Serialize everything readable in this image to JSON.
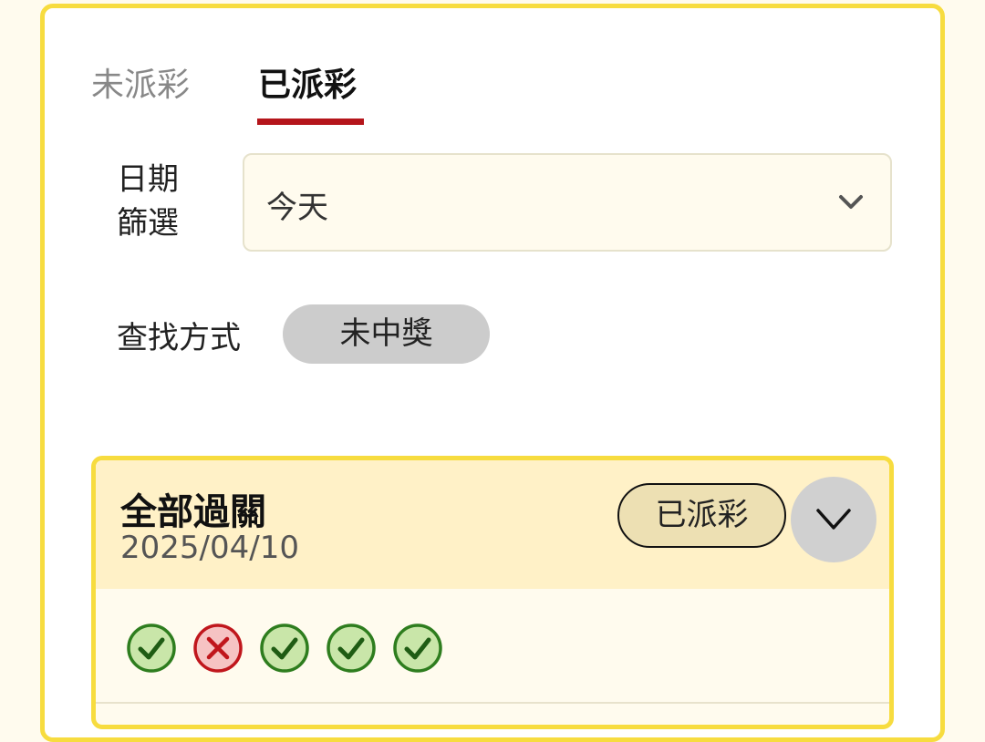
{
  "tabs": [
    {
      "label": "未派彩",
      "active": false
    },
    {
      "label": "已派彩",
      "active": true
    }
  ],
  "filter": {
    "date_label": "日期篩選",
    "date_value": "今天",
    "search_label": "查找方式",
    "search_option": "未中獎"
  },
  "bet_card": {
    "title": "全部過關",
    "date": "2025/04/10",
    "status": "已派彩",
    "results": [
      "win",
      "lose",
      "win",
      "win",
      "win"
    ]
  },
  "colors": {
    "accent_yellow": "#f7dc3f",
    "tab_underline": "#b5151b",
    "win_green": "#2e7d1e",
    "lose_red": "#c0161c"
  }
}
